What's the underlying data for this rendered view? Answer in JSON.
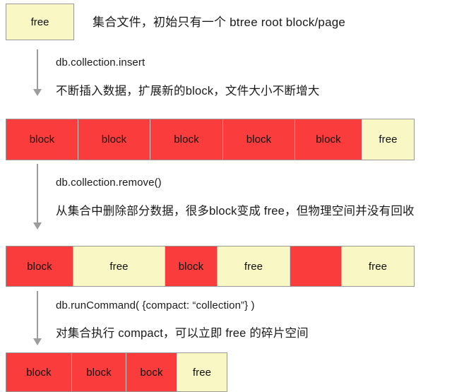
{
  "diagram": {
    "title": "MongoDB collection file block / free space compaction",
    "colors": {
      "block": "#fa3c3c",
      "free": "#f9f7c4",
      "border": "#999999",
      "arrow": "#9d9d9d",
      "text": "#1a1a1a"
    },
    "stages": [
      {
        "id": "initial",
        "bar_label": "initial-file-bar",
        "segments": [
          {
            "type": "free",
            "label": "free"
          }
        ],
        "caption": "集合文件，初始只有一个 btree root block/page"
      },
      {
        "id": "after-insert",
        "bar_label": "grown-file-bar",
        "segments": [
          {
            "type": "block",
            "label": "block"
          },
          {
            "type": "block",
            "label": "block"
          },
          {
            "type": "block",
            "label": "block"
          },
          {
            "type": "block",
            "label": "block"
          },
          {
            "type": "block",
            "label": "block"
          },
          {
            "type": "free",
            "label": "free"
          }
        ],
        "command": "db.collection.insert",
        "caption": "不断插入数据，扩展新的block，文件大小不断增大"
      },
      {
        "id": "after-remove",
        "bar_label": "fragmented-file-bar",
        "segments": [
          {
            "type": "block",
            "label": "block"
          },
          {
            "type": "free",
            "label": "free"
          },
          {
            "type": "block",
            "label": "block"
          },
          {
            "type": "free",
            "label": "free"
          },
          {
            "type": "block",
            "label": ""
          },
          {
            "type": "free",
            "label": "free"
          }
        ],
        "command": "db.collection.remove()",
        "caption": "从集合中删除部分数据，很多block变成 free，但物理空间并没有回收"
      },
      {
        "id": "after-compact",
        "bar_label": "compacted-file-bar",
        "segments": [
          {
            "type": "block",
            "label": "block"
          },
          {
            "type": "block",
            "label": "block"
          },
          {
            "type": "block",
            "label": "bock"
          },
          {
            "type": "free",
            "label": "free"
          }
        ],
        "command": "db.runCommand( {compact: “collection”} )",
        "caption": "对集合执行 compact，可以立即 free 的碎片空间"
      }
    ]
  }
}
